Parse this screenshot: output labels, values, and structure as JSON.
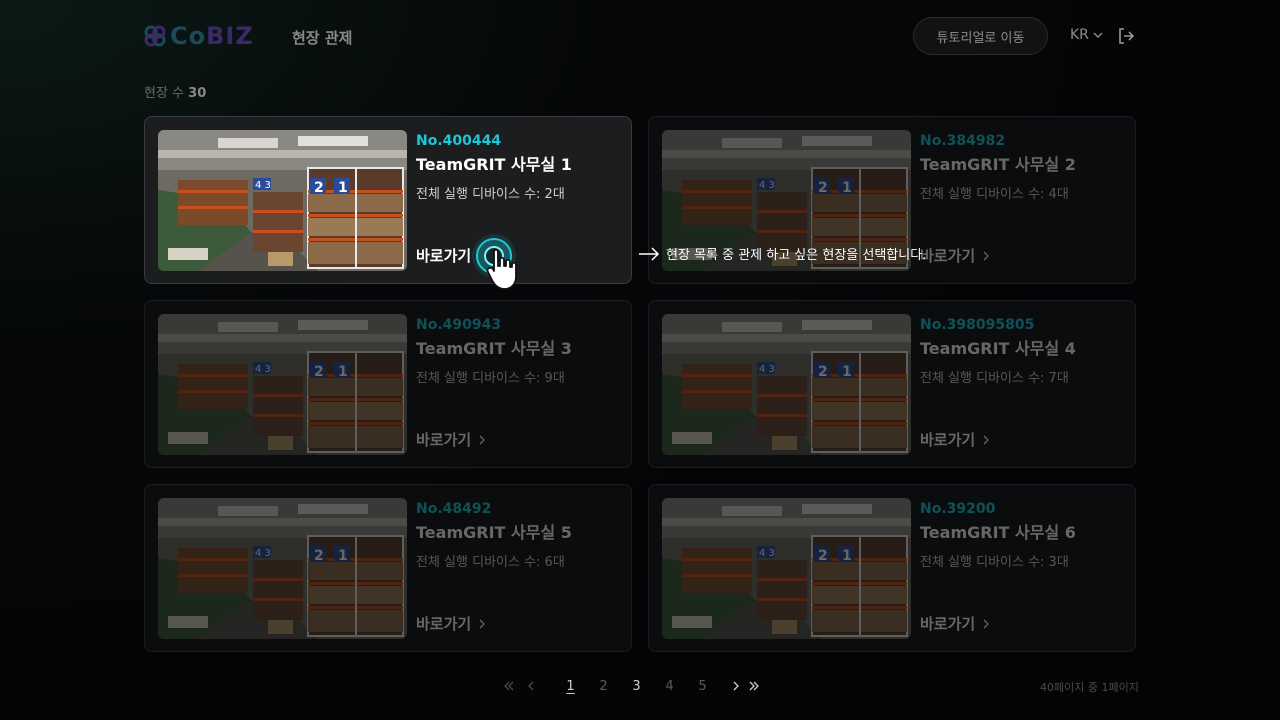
{
  "header": {
    "logo_text_a": "Co",
    "logo_text_b": "BIZ",
    "title": "현장 관제",
    "tutorial_label": "튜토리얼로 이동",
    "lang_label": "KR"
  },
  "summary": {
    "count_label": "현장 수",
    "count_value": "30"
  },
  "sites": [
    {
      "no": "No.400444",
      "name": "TeamGRIT 사무실 1",
      "devices": "전체 실행 디바이스 수: 2대",
      "goto": "바로가기"
    },
    {
      "no": "No.384982",
      "name": "TeamGRIT 사무실 2",
      "devices": "전체 실행 디바이스 수: 4대",
      "goto": "바로가기"
    },
    {
      "no": "No.490943",
      "name": "TeamGRIT 사무실 3",
      "devices": "전체 실행 디바이스 수: 9대",
      "goto": "바로가기"
    },
    {
      "no": "No.398095805",
      "name": "TeamGRIT 사무실 4",
      "devices": "전체 실행 디바이스 수: 7대",
      "goto": "바로가기"
    },
    {
      "no": "No.48492",
      "name": "TeamGRIT 사무실 5",
      "devices": "전체 실행 디바이스 수: 6대",
      "goto": "바로가기"
    },
    {
      "no": "No.39200",
      "name": "TeamGRIT 사무실 6",
      "devices": "전체 실행 디바이스 수: 3대",
      "goto": "바로가기"
    }
  ],
  "tutorial_tip": "현장 목록 중 관제 하고 싶은 현장을 선택합니다.",
  "pagination": {
    "pages": [
      "1",
      "2",
      "3",
      "4",
      "5"
    ],
    "current": "1",
    "summary": "40페이지 중 1페이지"
  },
  "colors": {
    "accent": "#19c9d8",
    "background": "#050607"
  }
}
